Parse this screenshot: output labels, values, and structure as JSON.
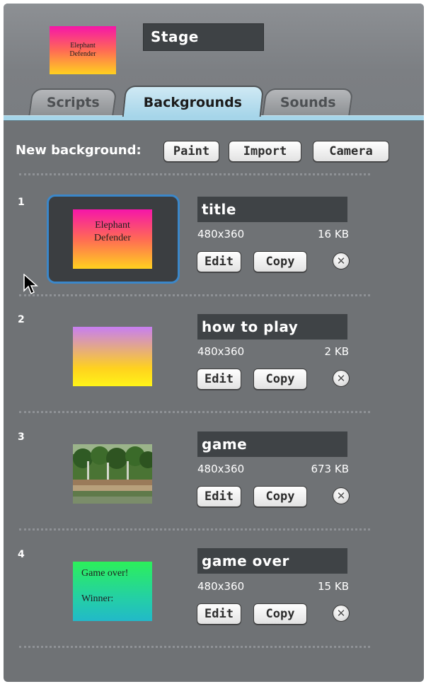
{
  "stage": {
    "thumb_text": "Elephant\nDefender",
    "name": "Stage"
  },
  "tabs": [
    {
      "label": "Scripts"
    },
    {
      "label": "Backgrounds"
    },
    {
      "label": "Sounds"
    }
  ],
  "new_background": {
    "label": "New background:",
    "paint": "Paint",
    "import": "Import",
    "camera": "Camera"
  },
  "backgrounds": [
    {
      "number": "1",
      "name": "title",
      "size": "480x360",
      "filesize": "16 KB",
      "thumb_text": "Elephant\nDefender",
      "selected": true
    },
    {
      "number": "2",
      "name": "how to play",
      "size": "480x360",
      "filesize": "2 KB",
      "thumb_text": ""
    },
    {
      "number": "3",
      "name": "game",
      "size": "480x360",
      "filesize": "673 KB",
      "thumb_text": ""
    },
    {
      "number": "4",
      "name": "game over",
      "size": "480x360",
      "filesize": "15 KB",
      "thumb_text": "Game over!\n\nWinner:"
    }
  ],
  "actions": {
    "edit": "Edit",
    "copy": "Copy",
    "delete_glyph": "✕"
  },
  "icons": {
    "delete": "close-circle-icon",
    "cursor": "mouse-pointer-icon"
  },
  "colors": {
    "panel": "#6f7275",
    "active_tab": "#a6d5e9",
    "selection": "#3b87c9"
  }
}
